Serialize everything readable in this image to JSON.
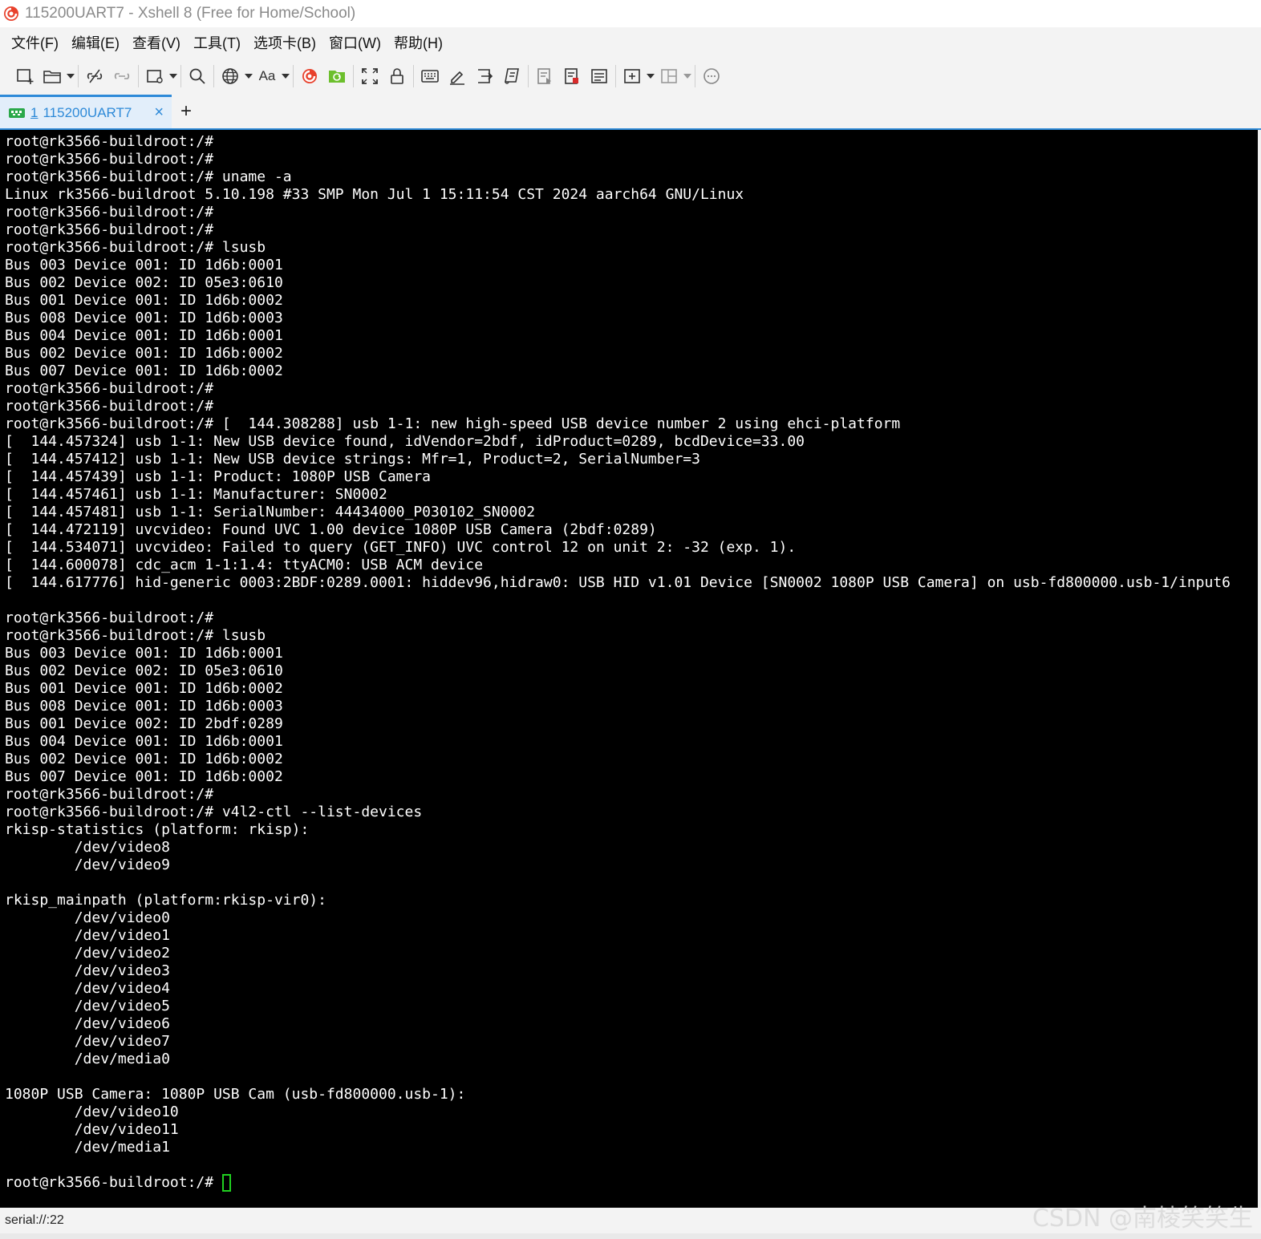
{
  "window": {
    "title": "115200UART7 - Xshell 8 (Free for Home/School)"
  },
  "menu": [
    "文件(F)",
    "编辑(E)",
    "查看(V)",
    "工具(T)",
    "选项卡(B)",
    "窗口(W)",
    "帮助(H)"
  ],
  "toolbar": {
    "font_button_label": "Aa",
    "icons": [
      "new-session-icon",
      "open-folder-icon",
      "disconnect-icon",
      "reconnect-icon",
      "new-window-icon",
      "search-icon",
      "globe-icon",
      "font-icon",
      "xshell-logo-icon",
      "xftp-icon",
      "fullscreen-icon",
      "lock-icon",
      "keyboard-icon",
      "pen-icon",
      "transfer-icon",
      "script-icon",
      "log-icon",
      "stop-icon",
      "notes-icon",
      "add-icon",
      "layout-icon",
      "chat-icon"
    ]
  },
  "tab": {
    "number": "1",
    "title": "115200UART7",
    "close": "×",
    "new": "+"
  },
  "terminal": {
    "lines": [
      "root@rk3566-buildroot:/#",
      "root@rk3566-buildroot:/#",
      "root@rk3566-buildroot:/# uname -a",
      "Linux rk3566-buildroot 5.10.198 #33 SMP Mon Jul 1 15:11:54 CST 2024 aarch64 GNU/Linux",
      "root@rk3566-buildroot:/#",
      "root@rk3566-buildroot:/#",
      "root@rk3566-buildroot:/# lsusb",
      "Bus 003 Device 001: ID 1d6b:0001",
      "Bus 002 Device 002: ID 05e3:0610",
      "Bus 001 Device 001: ID 1d6b:0002",
      "Bus 008 Device 001: ID 1d6b:0003",
      "Bus 004 Device 001: ID 1d6b:0001",
      "Bus 002 Device 001: ID 1d6b:0002",
      "Bus 007 Device 001: ID 1d6b:0002",
      "root@rk3566-buildroot:/#",
      "root@rk3566-buildroot:/#",
      "root@rk3566-buildroot:/# [  144.308288] usb 1-1: new high-speed USB device number 2 using ehci-platform",
      "[  144.457324] usb 1-1: New USB device found, idVendor=2bdf, idProduct=0289, bcdDevice=33.00",
      "[  144.457412] usb 1-1: New USB device strings: Mfr=1, Product=2, SerialNumber=3",
      "[  144.457439] usb 1-1: Product: 1080P USB Camera",
      "[  144.457461] usb 1-1: Manufacturer: SN0002",
      "[  144.457481] usb 1-1: SerialNumber: 44434000_P030102_SN0002",
      "[  144.472119] uvcvideo: Found UVC 1.00 device 1080P USB Camera (2bdf:0289)",
      "[  144.534071] uvcvideo: Failed to query (GET_INFO) UVC control 12 on unit 2: -32 (exp. 1).",
      "[  144.600078] cdc_acm 1-1:1.4: ttyACM0: USB ACM device",
      "[  144.617776] hid-generic 0003:2BDF:0289.0001: hiddev96,hidraw0: USB HID v1.01 Device [SN0002 1080P USB Camera] on usb-fd800000.usb-1/input6",
      "",
      "root@rk3566-buildroot:/#",
      "root@rk3566-buildroot:/# lsusb",
      "Bus 003 Device 001: ID 1d6b:0001",
      "Bus 002 Device 002: ID 05e3:0610",
      "Bus 001 Device 001: ID 1d6b:0002",
      "Bus 008 Device 001: ID 1d6b:0003",
      "Bus 001 Device 002: ID 2bdf:0289",
      "Bus 004 Device 001: ID 1d6b:0001",
      "Bus 002 Device 001: ID 1d6b:0002",
      "Bus 007 Device 001: ID 1d6b:0002",
      "root@rk3566-buildroot:/#",
      "root@rk3566-buildroot:/# v4l2-ctl --list-devices",
      "rkisp-statistics (platform: rkisp):",
      "        /dev/video8",
      "        /dev/video9",
      "",
      "rkisp_mainpath (platform:rkisp-vir0):",
      "        /dev/video0",
      "        /dev/video1",
      "        /dev/video2",
      "        /dev/video3",
      "        /dev/video4",
      "        /dev/video5",
      "        /dev/video6",
      "        /dev/video7",
      "        /dev/media0",
      "",
      "1080P USB Camera: 1080P USB Cam (usb-fd800000.usb-1):",
      "        /dev/video10",
      "        /dev/video11",
      "        /dev/media1",
      "",
      "root@rk3566-buildroot:/# "
    ]
  },
  "status": {
    "text": "serial://:22"
  },
  "watermark": "CSDN @南棱笑笑生",
  "colors": {
    "terminal_bg": "#000000",
    "terminal_fg": "#ffffff",
    "cursor": "#20d020",
    "accent": "#2e8ad8",
    "chrome_bg": "#f3f3f3"
  }
}
